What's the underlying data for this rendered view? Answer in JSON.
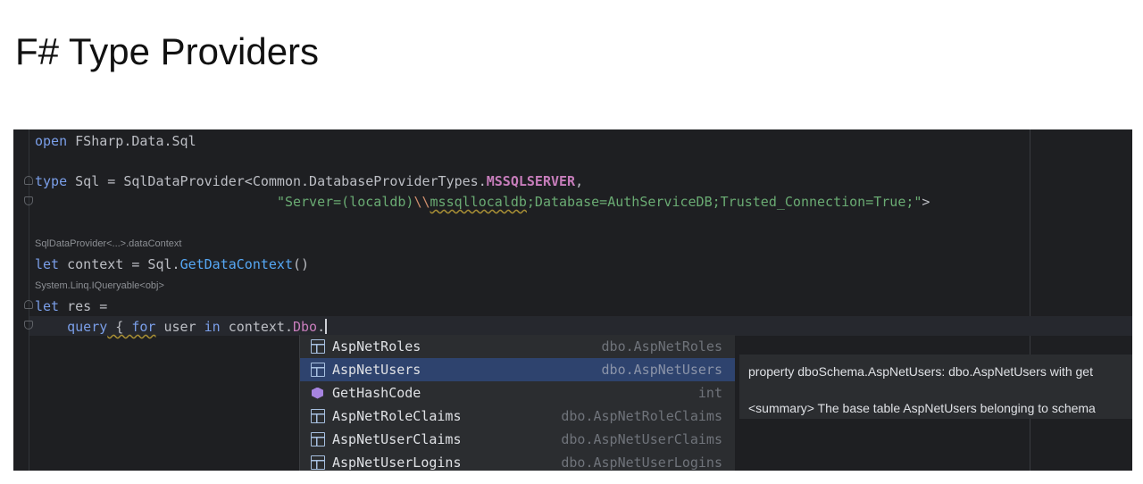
{
  "slide": {
    "title": "F# Type Providers"
  },
  "code": {
    "line1": {
      "kw": "open",
      "rest": " FSharp.Data.Sql"
    },
    "line2": {
      "kw": "type",
      "a": " Sql = SqlDataProvider<Common.DatabaseProviderTypes.",
      "enum": "MSSQLSERVER",
      "b": ","
    },
    "line3": {
      "indent": "                              ",
      "str_a": "\"Server=(localdb)",
      "esc": "\\\\",
      "sq": "mssqllocaldb",
      "str_b": ";Database=AuthServiceDB;Trusted_Connection=True;\"",
      "close": ">"
    },
    "hint1": "SqlDataProvider<...>.dataContext",
    "line4": {
      "kw": "let",
      "a": " context = Sql.",
      "fn": "GetDataContext",
      "b": "()"
    },
    "hint2": "System.Linq.IQueryable<obj>",
    "line5": {
      "kw": "let",
      "rest": " res ="
    },
    "line6": {
      "indent": "    ",
      "query": "query",
      "brace": " { ",
      "for": "for",
      "user": " user ",
      "in": "in",
      "ctx": " context.",
      "dbo": "Dbo",
      "dot": "."
    }
  },
  "completion": {
    "items": [
      {
        "name": "AspNetRoles",
        "type": "dbo.AspNetRoles",
        "icon": "table-icon"
      },
      {
        "name": "AspNetUsers",
        "type": "dbo.AspNetUsers",
        "icon": "table-icon"
      },
      {
        "name": "GetHashCode",
        "type": "int",
        "icon": "method-icon"
      },
      {
        "name": "AspNetRoleClaims",
        "type": "dbo.AspNetRoleClaims",
        "icon": "table-icon"
      },
      {
        "name": "AspNetUserClaims",
        "type": "dbo.AspNetUserClaims",
        "icon": "table-icon"
      },
      {
        "name": "AspNetUserLogins",
        "type": "dbo.AspNetUserLogins",
        "icon": "table-icon"
      }
    ],
    "selected_index": 1
  },
  "doc": {
    "signature": "property dboSchema.AspNetUsers: dbo.AspNetUsers with get",
    "summary": "<summary> The base table AspNetUsers belonging to schema"
  },
  "colors": {
    "editor_bg": "#1e1f22",
    "keyword": "#cf8e6d",
    "string": "#6aab73",
    "function": "#56a8f5",
    "enum": "#c77dbb",
    "selection": "#2e436e"
  }
}
